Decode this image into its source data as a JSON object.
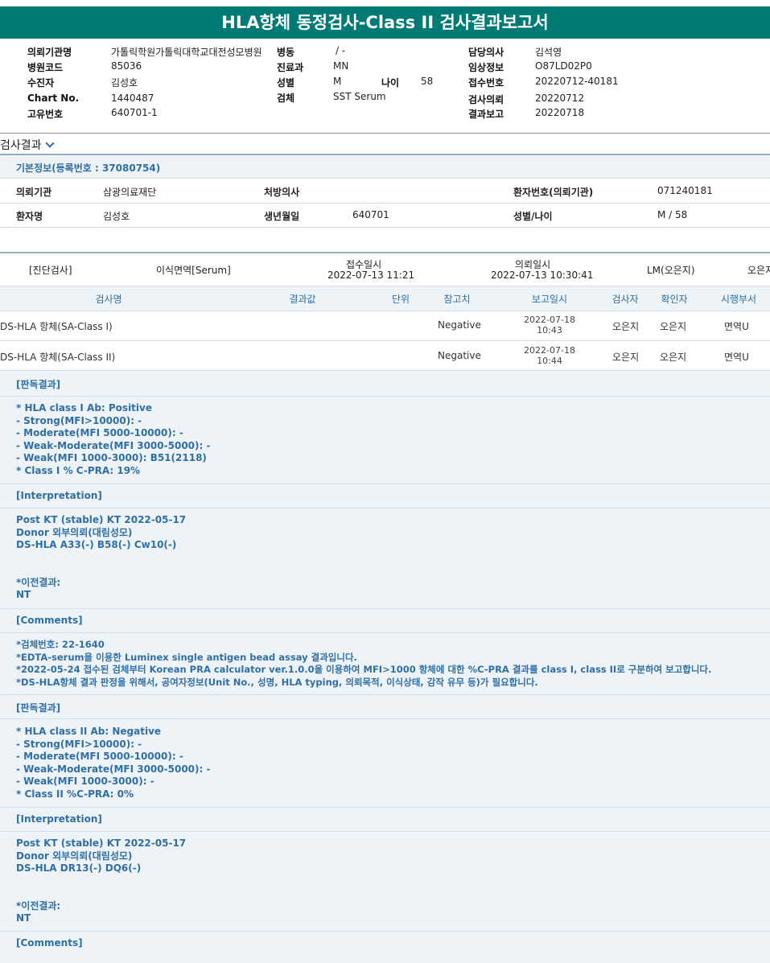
{
  "title": "HLA항체 동정검사-Class II 검사결과보고서",
  "header": {
    "requesting_org_label": "의뢰기관명",
    "requesting_org": "가톨릭학원가톨릭대학교대전성모병원",
    "ward_label": "병동",
    "ward": "/ -",
    "attending_label": "담당의사",
    "attending": "김석영",
    "hospital_code_label": "병원코드",
    "hospital_code": "85036",
    "dept_label": "진료과",
    "dept": "MN",
    "clinical_label": "임상정보",
    "clinical": "O87LD02P0",
    "patient_label": "수진자",
    "patient": "김성호",
    "sex_label": "성별",
    "sex": "M",
    "age_label": "나이",
    "age": "58",
    "receipt_no_label": "접수번호",
    "receipt_no": "20220712-40181",
    "chart_label": "Chart No.",
    "chart": "1440487",
    "specimen_label": "검체",
    "specimen": "SST Serum",
    "request_date_label": "검사의뢰",
    "request_date": "20220712",
    "unique_label": "고유번호",
    "unique": "640701-1",
    "report_date_label": "결과보고",
    "report_date": "20220718"
  },
  "section": {
    "title": "검사결과",
    "basic_info": "기본정보(등록번호 : 37080754)",
    "org_label": "의뢰기관",
    "org": "삼광의료재단",
    "doctor_label": "처방의사",
    "doctor": "",
    "patno_label": "환자번호(의뢰기관)",
    "patno": "071240181",
    "name_label": "환자명",
    "name": "김성호",
    "birth_label": "생년월일",
    "birth": "640701",
    "sexage_label": "성별/나이",
    "sexage": "M / 58"
  },
  "order": {
    "category": "[진단검사]",
    "test_group": "이식면역[Serum]",
    "received_label": "접수일시",
    "received": "2022-07-13  11:21",
    "requested_label": "의뢰일시",
    "requested": "2022-07-13  10:30:41",
    "lab": "LM(오은지)",
    "lab2": "오은지"
  },
  "table": {
    "headers": [
      "검사명",
      "결과값",
      "단위",
      "참고치",
      "보고일시",
      "검사자",
      "확인자",
      "시행부서"
    ],
    "rows": [
      {
        "name": "DS-HLA 항체(SA-Class I)",
        "ref": "Negative",
        "date": "2022-07-18",
        "time": "10:43",
        "tester": "오은지",
        "confirmer": "오은지",
        "dept": "면역U"
      },
      {
        "name": "DS-HLA 항체(SA-Class II)",
        "ref": "Negative",
        "date": "2022-07-18",
        "time": "10:44",
        "tester": "오은지",
        "confirmer": "오은지",
        "dept": "면역U"
      }
    ]
  },
  "results": {
    "t1": "[판독결과]",
    "b1": "* HLA class I Ab: Positive\n- Strong(MFI>10000): -\n- Moderate(MFI 5000-10000): -\n- Weak-Moderate(MFI 3000-5000): -\n- Weak(MFI 1000-3000): B51(2118)\n* Class I % C-PRA: 19%",
    "t2": "[Interpretation]",
    "b2": "Post KT (stable) KT 2022-05-17\nDonor 외부의뢰(대림성모)\nDS-HLA A33(-) B58(-) Cw10(-)\n\n\n*이전결과:\nNT",
    "t3": "[Comments]",
    "b3": "*검체번호: 22-1640\n*EDTA-serum을 이용한 Luminex single antigen bead assay 결과입니다.\n*2022-05-24 접수된 검체부터 Korean PRA calculator ver.1.0.0을 이용하여 MFI>1000 항체에 대한 %C-PRA 결과를 class I, class II로 구분하여 보고합니다.\n*DS-HLA항체 결과 판정을 위해서, 공여자정보(Unit No., 성명, HLA typing, 의뢰목적, 이식상태, 감작 유무 등)가 필요합니다.",
    "t4": "[판독결과]",
    "b4": "* HLA class II Ab: Negative\n- Strong(MFI>10000): -\n- Moderate(MFI 5000-10000): -\n- Weak-Moderate(MFI 3000-5000): -\n- Weak(MFI 1000-3000): -\n* Class II %C-PRA: 0%",
    "t5": "[Interpretation]",
    "b5": "Post KT (stable) KT 2022-05-17\nDonor 외부의뢰(대림성모)\nDS-HLA DR13(-) DQ6(-)\n\n\n*이전결과:\nNT",
    "t6": "[Comments]"
  }
}
